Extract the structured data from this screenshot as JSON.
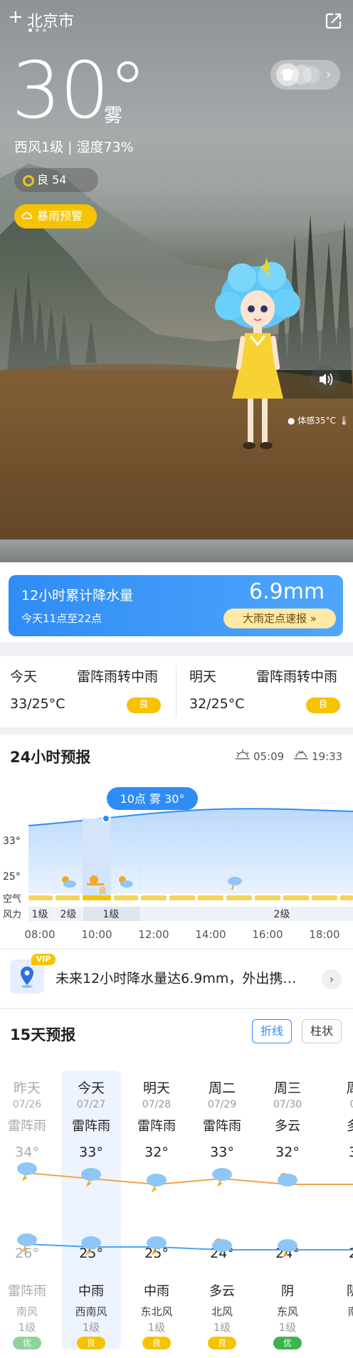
{
  "header": {
    "plus": "+",
    "city": "北京市"
  },
  "current": {
    "temp": "30°",
    "condition": "雾",
    "wind_humidity": "西风1级 | 湿度73%",
    "aqi": "良 54",
    "warning": "暴雨预警",
    "feels_like": "体感35°C"
  },
  "rain_card": {
    "title": "12小时累计降水量",
    "period": "今天11点至22点",
    "amount": "6.9mm",
    "button": "大雨定点速报 »"
  },
  "days_summary": [
    {
      "label": "今天",
      "weather": "雷阵雨转中雨",
      "temps": "33/25°C",
      "aqi": "良"
    },
    {
      "label": "明天",
      "weather": "雷阵雨转中雨",
      "temps": "32/25°C",
      "aqi": "良"
    }
  ],
  "hourly": {
    "title": "24小时预报",
    "sunrise": "05:09",
    "sunset": "19:33",
    "tooltip": "10点 雾 30°",
    "y_labels": [
      "33°",
      "25°"
    ],
    "row_labels": [
      "空气",
      "风力"
    ],
    "selected_aqi": "良",
    "wind_levels": [
      "1级",
      "2级",
      "1级",
      "2级"
    ],
    "times": [
      "08:00",
      "10:00",
      "12:00",
      "14:00",
      "16:00",
      "18:00"
    ]
  },
  "tip": {
    "badge": "VIP",
    "text": "未来12小时降水量达6.9mm，外出携…",
    "arrow": "›"
  },
  "daily": {
    "title": "15天预报",
    "tabs": [
      "折线",
      "柱状"
    ],
    "days": [
      {
        "name": "昨天",
        "date": "07/26",
        "day_weather": "雷阵雨",
        "high": "34°",
        "low": "26°",
        "night_weather": "雷阵雨",
        "wind_dir": "南风",
        "wind_level": "1级",
        "aqi": "优",
        "aqi_level": "good",
        "past": true
      },
      {
        "name": "今天",
        "date": "07/27",
        "day_weather": "雷阵雨",
        "high": "33°",
        "low": "25°",
        "night_weather": "中雨",
        "wind_dir": "西南风",
        "wind_level": "1级",
        "aqi": "良",
        "aqi_level": "fair",
        "today": true
      },
      {
        "name": "明天",
        "date": "07/28",
        "day_weather": "雷阵雨",
        "high": "32°",
        "low": "25°",
        "night_weather": "中雨",
        "wind_dir": "东北风",
        "wind_level": "1级",
        "aqi": "良",
        "aqi_level": "fair"
      },
      {
        "name": "周二",
        "date": "07/29",
        "day_weather": "雷阵雨",
        "high": "33°",
        "low": "24°",
        "night_weather": "多云",
        "wind_dir": "北风",
        "wind_level": "1级",
        "aqi": "良",
        "aqi_level": "fair"
      },
      {
        "name": "周三",
        "date": "07/30",
        "day_weather": "多云",
        "high": "32°",
        "low": "24°",
        "night_weather": "阴",
        "wind_dir": "东风",
        "wind_level": "1级",
        "aqi": "优",
        "aqi_level": "good"
      },
      {
        "name": "周",
        "date": "0",
        "day_weather": "多",
        "high": "3",
        "low": "2",
        "night_weather": "阴",
        "wind_dir": "南",
        "wind_level": "",
        "aqi": "",
        "aqi_level": "fair"
      }
    ]
  },
  "colors": {
    "accent": "#2f8cf5",
    "warning": "#f5c300",
    "good": "#3ab54a",
    "high_line": "#f3a14b",
    "low_line": "#4aa3f0"
  }
}
